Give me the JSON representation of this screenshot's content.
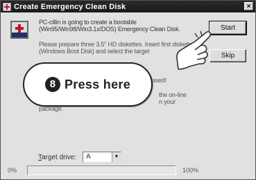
{
  "window": {
    "title": "Create Emergency Clean Disk",
    "close_glyph": "×",
    "icon": "pccillin-cross-icon"
  },
  "body": {
    "intro": "PC-cillin is going to create a bootable (Win95/Win98/Win3.1x/DOS) Emergency Clean Disk.",
    "instructions": "Please prepare three 3.5\" HD diskettes. Insert first diskette (Windows Boot Disk) and select the target",
    "fragment_1": "rased!",
    "fragment_2": "the on-line",
    "fragment_3": "n your",
    "fragment_4": "package."
  },
  "buttons": {
    "start": "Start",
    "skip": "Skip"
  },
  "callout": {
    "step": "8",
    "text": "Press here"
  },
  "drive": {
    "label": "Target drive:",
    "label_accel": "T",
    "label_rest": "arget drive:",
    "value": "A",
    "arrow": "▼"
  },
  "progress": {
    "min_label": "0%",
    "max_label": "100%",
    "value": 0
  },
  "colors": {
    "titlebar": "#1a1a1a",
    "accent": "#1f2f6a",
    "brand_red": "#c8102e"
  }
}
